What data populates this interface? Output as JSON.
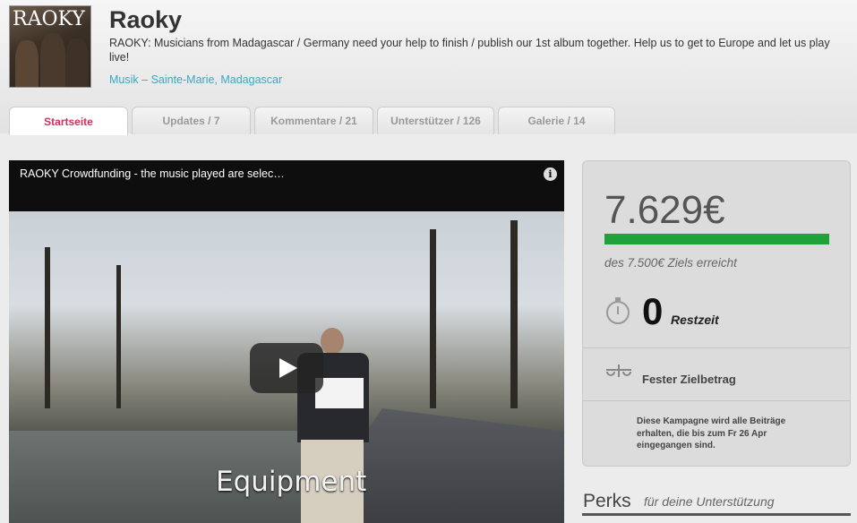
{
  "project": {
    "cover_label": "RAOKY",
    "title": "Raoky",
    "description": "RAOKY: Musicians from Madagascar / Germany need your help to finish / publish our 1st album together. Help us to get to Europe and let us play live!",
    "category": "Musik",
    "separator": " – ",
    "location": "Sainte-Marie, Madagascar"
  },
  "tabs": [
    {
      "label": "Startseite",
      "active": true
    },
    {
      "label": "Updates / 7",
      "active": false
    },
    {
      "label": "Kommentare / 21",
      "active": false
    },
    {
      "label": "Unterstützer / 126",
      "active": false
    },
    {
      "label": "Galerie / 14",
      "active": false
    }
  ],
  "video": {
    "title": "RAOKY Crowdfunding - the music played are selec…",
    "info_icon": "i",
    "caption": "Equipment"
  },
  "stats": {
    "amount": "7.629€",
    "progress_fraction": 1.0,
    "goal_text": "des 7.500€ Ziels erreicht",
    "days_left": "0",
    "days_label": "Restzeit",
    "funding_type": "Fester Zielbetrag",
    "note": "Diese Kampagne wird alle Beiträge erhalten, die bis zum Fr 26 Apr eingegangen sind.",
    "accent_color": "#1fa13b"
  },
  "perks": {
    "title": "Perks",
    "subtitle": "für deine Unterstützung"
  }
}
